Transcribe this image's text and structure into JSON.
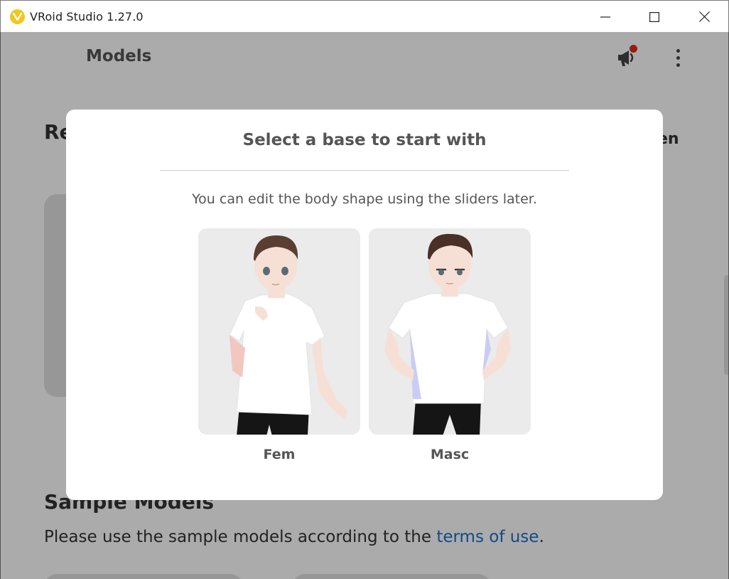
{
  "window": {
    "title": "VRoid Studio 1.27.0",
    "controls": {
      "minimize": "minimize-icon",
      "maximize": "maximize-icon",
      "close": "close-icon"
    }
  },
  "header": {
    "title": "Models",
    "announcement_icon": "megaphone-icon",
    "notification_color": "#e0291e",
    "menu_icon": "more-vertical-icon"
  },
  "background": {
    "recent_title_fragment": "Re",
    "right_title_fragment": "en",
    "sample": {
      "title": "Sample Models",
      "desc_prefix": "Please use the sample models according to the ",
      "terms_link": "terms of use",
      "desc_suffix": "."
    }
  },
  "modal": {
    "title": "Select a base to start with",
    "subtitle": "You can edit the body shape using the sliders later.",
    "options": [
      {
        "label": "Fem"
      },
      {
        "label": "Masc"
      }
    ]
  },
  "colors": {
    "accent_link": "#1a6fc9",
    "logo": "#f3c51d",
    "card_bg": "#ebebeb"
  }
}
